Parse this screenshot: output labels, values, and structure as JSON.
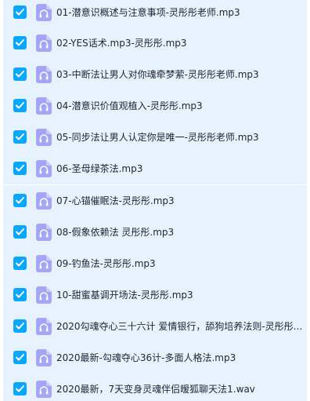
{
  "colors": {
    "row_background": "#e7f2ff",
    "checkbox_fill": "#06a7ff",
    "audio_icon_fill": "#a3a6f7",
    "text": "#222633"
  },
  "files": [
    {
      "name": "01-潜意识概述与注意事项-灵彤彤老师.mp3",
      "checked": true,
      "icon": "audio-file-icon"
    },
    {
      "name": "02-YES话术.mp3-灵彤彤.mp3",
      "checked": true,
      "icon": "audio-file-icon"
    },
    {
      "name": "03-中断法让男人对你魂牵梦萦-灵彤彤老师.mp3",
      "checked": true,
      "icon": "audio-file-icon"
    },
    {
      "name": "04-潜意识价值观植入-灵彤彤.mp3",
      "checked": true,
      "icon": "audio-file-icon"
    },
    {
      "name": "05-同步法让男人认定你是唯一-灵彤彤老师.mp3",
      "checked": true,
      "icon": "audio-file-icon"
    },
    {
      "name": "06-圣母绿茶法.mp3",
      "checked": true,
      "icon": "audio-file-icon"
    },
    {
      "name": "07-心锚催眠法-灵彤彤.mp3",
      "checked": true,
      "icon": "audio-file-icon"
    },
    {
      "name": "08-假象依赖法 灵彤彤.mp3",
      "checked": true,
      "icon": "audio-file-icon"
    },
    {
      "name": "09-钓鱼法-灵彤彤.mp3",
      "checked": true,
      "icon": "audio-file-icon"
    },
    {
      "name": "10-甜蜜基调开场法-灵彤彤.mp3",
      "checked": true,
      "icon": "audio-file-icon"
    },
    {
      "name": "2020勾魂夺心三十六计 爱情银行，舔狗培养法则-灵彤彤...",
      "checked": true,
      "icon": "audio-file-icon"
    },
    {
      "name": "2020最新-勾魂夺心36计-多面人格法.mp3",
      "checked": true,
      "icon": "audio-file-icon"
    },
    {
      "name": "2020最新，7天变身灵魂伴侣暧狐聊天法1.wav",
      "checked": true,
      "icon": "audio-file-icon"
    }
  ]
}
